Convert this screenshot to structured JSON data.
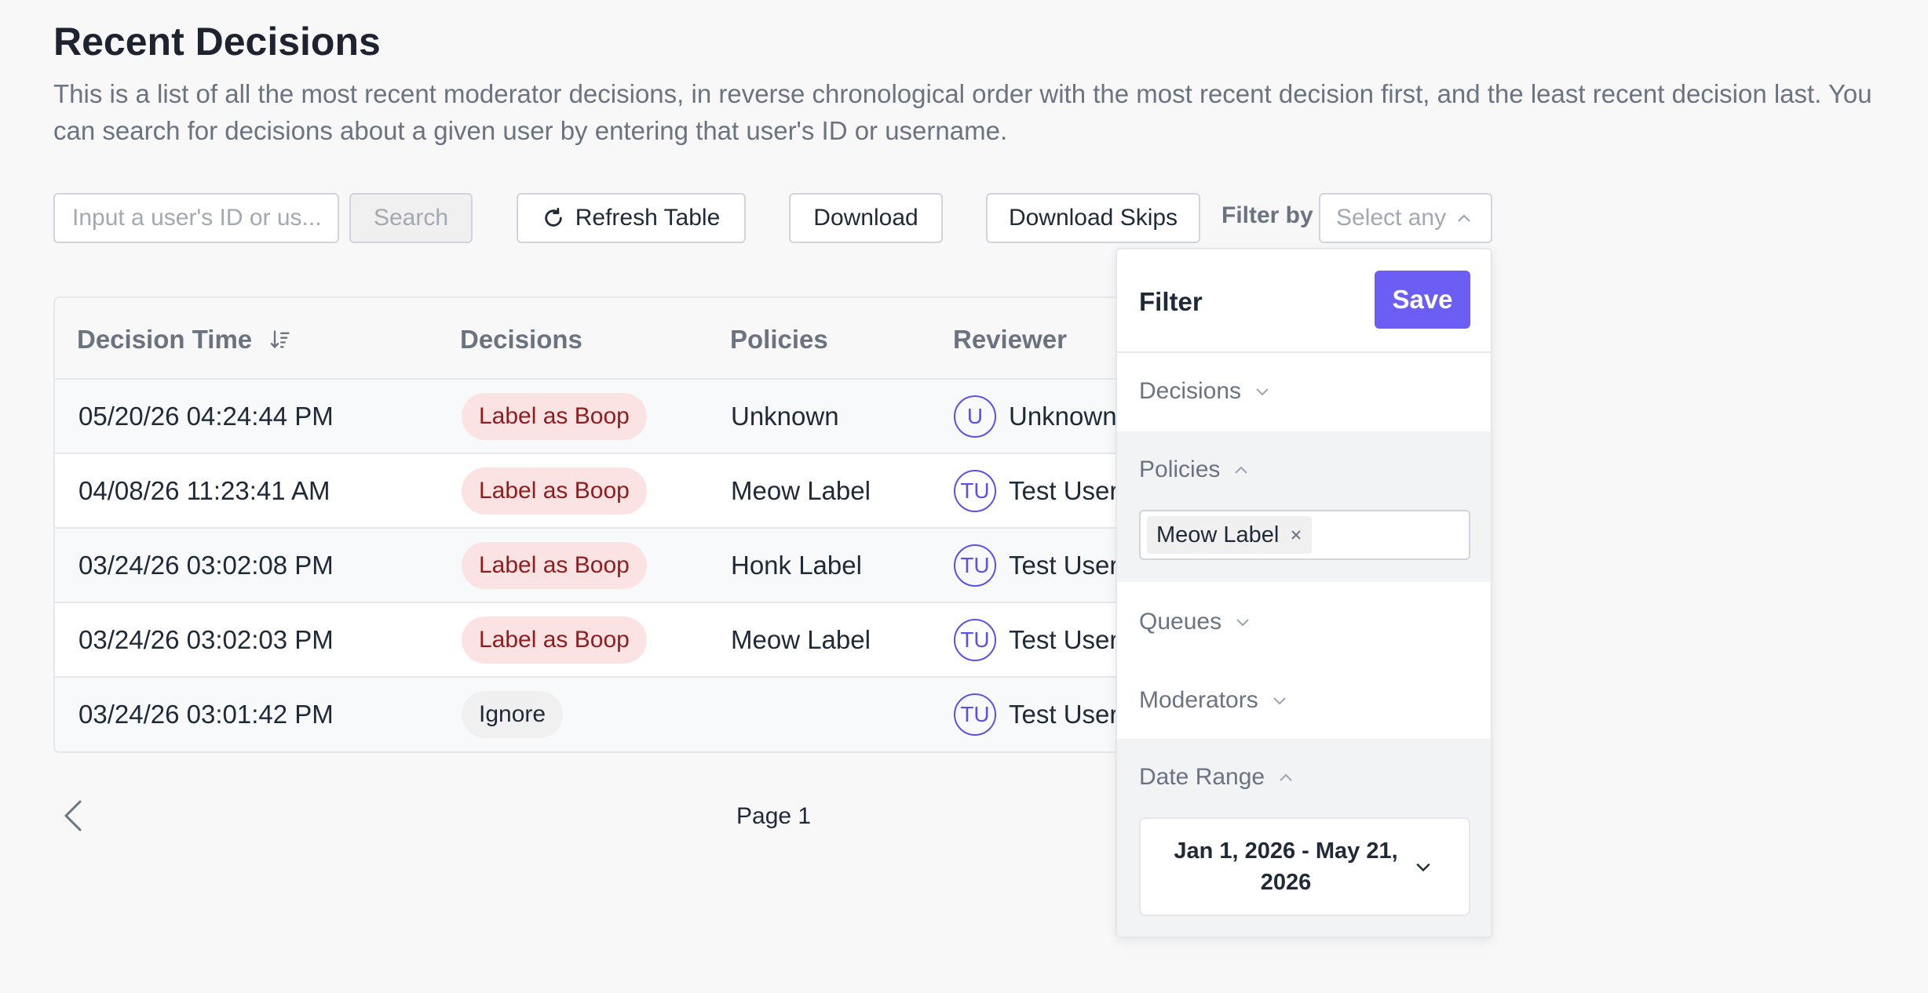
{
  "header": {
    "title": "Recent Decisions",
    "description": "This is a list of all the most recent moderator decisions, in reverse chronological order with the most recent decision first, and the least recent decision last. You can search for decisions about a given user by entering that user's ID or username."
  },
  "toolbar": {
    "search_placeholder": "Input a user's ID or us...",
    "search_label": "Search",
    "refresh_label": "Refresh Table",
    "download_label": "Download",
    "download_skips_label": "Download Skips",
    "filter_by_label": "Filter by",
    "select_placeholder": "Select any"
  },
  "table": {
    "columns": [
      "Decision Time",
      "Decisions",
      "Policies",
      "Reviewer"
    ],
    "rows": [
      {
        "time": "05/20/26 04:24:44 PM",
        "decision": "Label as Boop",
        "decision_style": "red",
        "policy": "Unknown",
        "avatar": "U",
        "reviewer": "Unknown"
      },
      {
        "time": "04/08/26 11:23:41 AM",
        "decision": "Label as Boop",
        "decision_style": "red",
        "policy": "Meow Label",
        "avatar": "TU",
        "reviewer": "Test User"
      },
      {
        "time": "03/24/26 03:02:08 PM",
        "decision": "Label as Boop",
        "decision_style": "red",
        "policy": "Honk Label",
        "avatar": "TU",
        "reviewer": "Test User"
      },
      {
        "time": "03/24/26 03:02:03 PM",
        "decision": "Label as Boop",
        "decision_style": "red",
        "policy": "Meow Label",
        "avatar": "TU",
        "reviewer": "Test User"
      },
      {
        "time": "03/24/26 03:01:42 PM",
        "decision": "Ignore",
        "decision_style": "gray",
        "policy": "",
        "avatar": "TU",
        "reviewer": "Test User"
      }
    ]
  },
  "pagination": {
    "page_label": "Page 1"
  },
  "filter_panel": {
    "title": "Filter",
    "save_label": "Save",
    "sections": {
      "decisions": "Decisions",
      "policies": "Policies",
      "queues": "Queues",
      "moderators": "Moderators",
      "date_range": "Date Range"
    },
    "policy_tag": "Meow Label",
    "date_range_value": "Jan 1, 2026 - May 21, 2026"
  },
  "colors": {
    "accent": "#6c5ef5",
    "avatar": "#5b50ea",
    "decision_red_bg": "#fbe3e3",
    "decision_red_text": "#8f1d1d"
  }
}
